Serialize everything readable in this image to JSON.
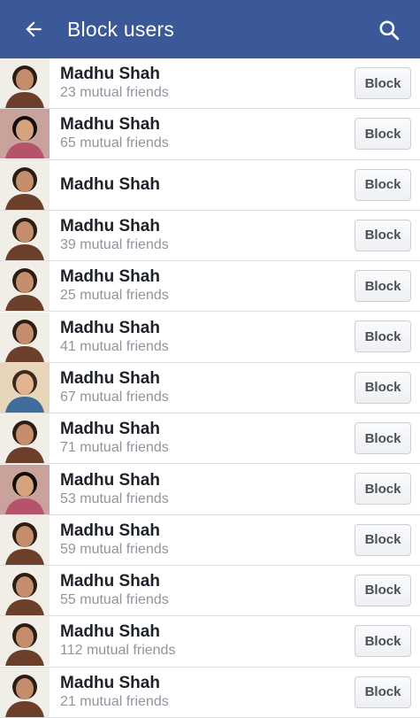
{
  "header": {
    "title": "Block users",
    "back_icon": "arrow-left-icon",
    "search_icon": "search-icon",
    "background": "#3b5998"
  },
  "users": [
    {
      "name": "Madhu Shah",
      "mutual": "23 mutual friends",
      "button": "Block",
      "avatar": "a"
    },
    {
      "name": "Madhu Shah",
      "mutual": "65 mutual friends",
      "button": "Block",
      "avatar": "b"
    },
    {
      "name": "Madhu Shah",
      "mutual": "",
      "button": "Block",
      "avatar": "a"
    },
    {
      "name": "Madhu Shah",
      "mutual": "39 mutual friends",
      "button": "Block",
      "avatar": "a"
    },
    {
      "name": "Madhu Shah",
      "mutual": "25 mutual friends",
      "button": "Block",
      "avatar": "a"
    },
    {
      "name": "Madhu Shah",
      "mutual": "41 mutual friends",
      "button": "Block",
      "avatar": "a"
    },
    {
      "name": "Madhu Shah",
      "mutual": "67 mutual friends",
      "button": "Block",
      "avatar": "c"
    },
    {
      "name": "Madhu Shah",
      "mutual": "71 mutual friends",
      "button": "Block",
      "avatar": "a"
    },
    {
      "name": "Madhu Shah",
      "mutual": "53 mutual friends",
      "button": "Block",
      "avatar": "b"
    },
    {
      "name": "Madhu Shah",
      "mutual": "59 mutual friends",
      "button": "Block",
      "avatar": "a"
    },
    {
      "name": "Madhu Shah",
      "mutual": "55 mutual friends",
      "button": "Block",
      "avatar": "a"
    },
    {
      "name": "Madhu Shah",
      "mutual": "112 mutual friends",
      "button": "Block",
      "avatar": "a"
    },
    {
      "name": "Madhu Shah",
      "mutual": "21 mutual friends",
      "button": "Block",
      "avatar": "a"
    }
  ]
}
